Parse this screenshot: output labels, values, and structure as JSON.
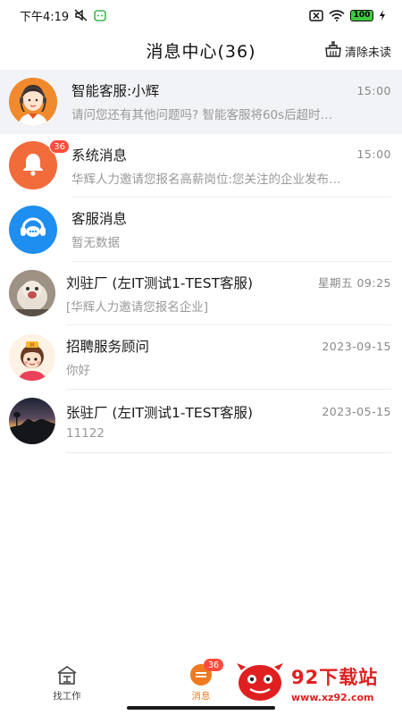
{
  "status_bar": {
    "time": "下午4:19",
    "battery": "100"
  },
  "header": {
    "title": "消息中心(36)",
    "clear_unread": "清除未读"
  },
  "messages": [
    {
      "name": "智能客服:小辉",
      "time": "15:00",
      "preview": "请问您还有其他问题吗? 智能客服将60s后超时…",
      "avatar": "agent-avatar",
      "highlighted": true
    },
    {
      "name": "系统消息",
      "time": "15:00",
      "preview": "华辉人力邀请您报名高薪岗位:您关注的企业发布…",
      "avatar": "bell-icon",
      "badge": "36"
    },
    {
      "name": "客服消息",
      "time": "",
      "preview": "暂无数据",
      "avatar": "headset-icon"
    },
    {
      "name": "刘驻厂 (左IT测试1-TEST客服)",
      "time": "星期五 09:25",
      "preview": "[华辉人力邀请您报名企业]",
      "avatar": "dog-photo"
    },
    {
      "name": "招聘服务顾问",
      "time": "2023-09-15",
      "preview": "你好",
      "avatar": "cartoon-girl"
    },
    {
      "name": "张驻厂 (左IT测试1-TEST客服)",
      "time": "2023-05-15",
      "preview": "11122",
      "avatar": "sunset-photo"
    }
  ],
  "bottom_nav": {
    "find_job": "找工作",
    "messages": "消息",
    "messages_badge": "36"
  },
  "watermark": {
    "title": "92下载站",
    "url": "www.xz92.com"
  },
  "colors": {
    "accent": "#f07a1e",
    "badge": "#ff4d3d",
    "watermark": "#e02020",
    "highlight_row": "#f2f3f7"
  }
}
